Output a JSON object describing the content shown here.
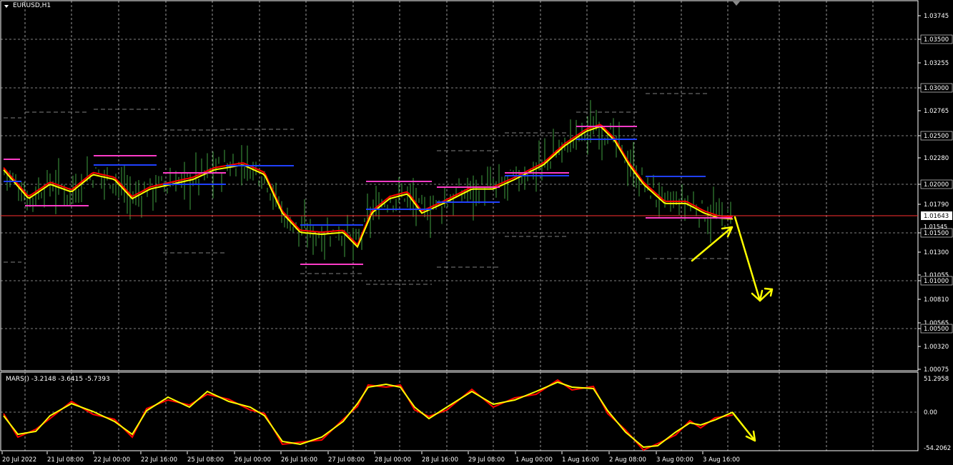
{
  "main": {
    "symbol_label": "EURUSD,H1",
    "price_axis_labels": [
      "1.03745",
      "1.03500",
      "1.03255",
      "1.03000",
      "1.02765",
      "1.02500",
      "1.02280",
      "1.02000",
      "1.01790",
      "1.01500",
      "1.01300",
      "1.01055",
      "1.01000",
      "1.00810",
      "1.00565",
      "1.00500",
      "1.00320",
      "1.00075"
    ],
    "current_price_label": "1.01643",
    "secondary_price_label": "1.01545"
  },
  "indicator": {
    "label": "MARS() -3.2148 -3.6415 -5.7393",
    "axis_labels": [
      "51.2958",
      "0.00",
      "-54.2062"
    ]
  },
  "time_axis": {
    "labels": [
      "20 Jul 2022",
      "21 Jul 08:00",
      "22 Jul 00:00",
      "22 Jul 16:00",
      "25 Jul 08:00",
      "26 Jul 00:00",
      "26 Jul 16:00",
      "27 Jul 08:00",
      "28 Jul 00:00",
      "28 Jul 16:00",
      "29 Jul 08:00",
      "1 Aug 00:00",
      "1 Aug 16:00",
      "2 Aug 08:00",
      "3 Aug 00:00",
      "3 Aug 16:00"
    ]
  },
  "colors": {
    "background": "#000000",
    "grid": "#ffffff",
    "candles": "#3fa03f",
    "ma_fast": "#ff0000",
    "ma_slow": "#ffff00",
    "level_magenta": "#ff3cc8",
    "level_blue": "#2040ff",
    "level_gray": "#808080",
    "current_price_line": "#ff3030",
    "arrows": "#ffff00"
  }
}
